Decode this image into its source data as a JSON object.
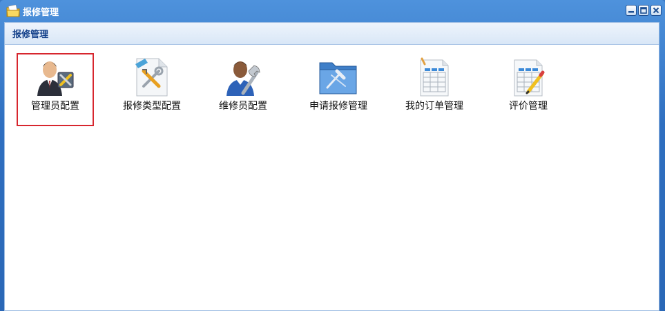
{
  "window": {
    "title": "报修管理",
    "title_icon": "folder-icon",
    "controls": [
      "minimize-icon",
      "maximize-icon",
      "close-icon"
    ]
  },
  "panel": {
    "title": "报修管理"
  },
  "apps": [
    {
      "label": "管理员配置",
      "icon": "admin-config-icon",
      "selected": true
    },
    {
      "label": "报修类型配置",
      "icon": "tools-icon",
      "selected": false
    },
    {
      "label": "维修员配置",
      "icon": "repairman-icon",
      "selected": false
    },
    {
      "label": "申请报修管理",
      "icon": "blue-folder-icon",
      "selected": false
    },
    {
      "label": "我的订单管理",
      "icon": "spreadsheet-icon",
      "selected": false
    },
    {
      "label": "评价管理",
      "icon": "spreadsheet-edit-icon",
      "selected": false
    }
  ],
  "colors": {
    "titlebar": "#2f6fc0",
    "selection_border": "#d7262e",
    "panel_title": "#15428b"
  }
}
